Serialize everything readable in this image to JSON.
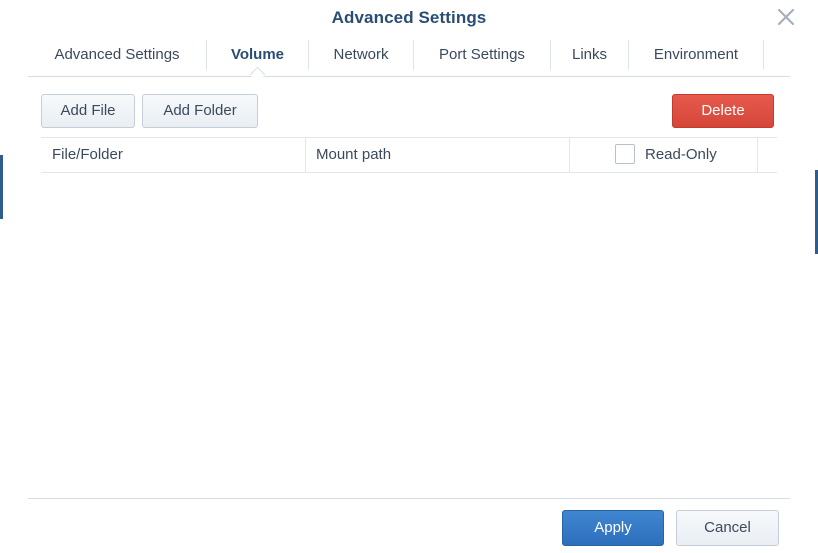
{
  "dialog": {
    "title": "Advanced Settings",
    "close_icon": "close-icon"
  },
  "tabs": [
    {
      "label": "Advanced Settings",
      "active": false
    },
    {
      "label": "Volume",
      "active": true
    },
    {
      "label": "Network",
      "active": false
    },
    {
      "label": "Port Settings",
      "active": false
    },
    {
      "label": "Links",
      "active": false
    },
    {
      "label": "Environment",
      "active": false
    }
  ],
  "toolbar": {
    "add_file_label": "Add File",
    "add_folder_label": "Add Folder",
    "delete_label": "Delete"
  },
  "grid": {
    "columns": [
      "File/Folder",
      "Mount path",
      "Read-Only"
    ],
    "read_only_checked": false,
    "rows": []
  },
  "footer": {
    "apply_label": "Apply",
    "cancel_label": "Cancel"
  },
  "colors": {
    "title": "#2a4d75",
    "delete": "#d9483b",
    "apply": "#3578c6"
  }
}
